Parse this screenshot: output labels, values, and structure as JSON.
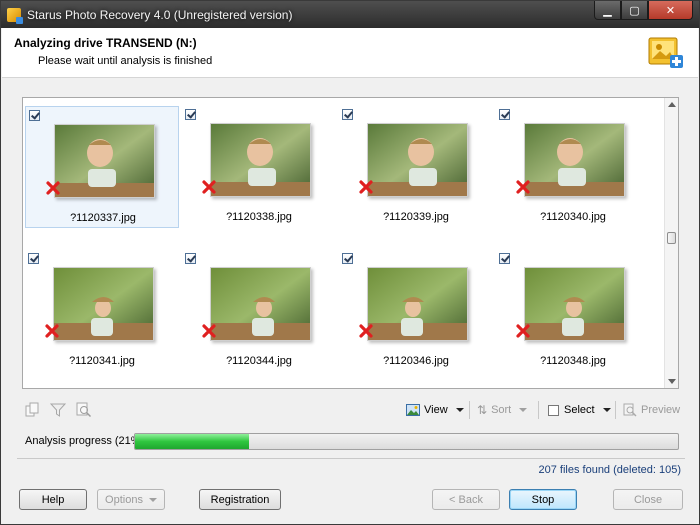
{
  "window": {
    "title": "Starus Photo Recovery 4.0 (Unregistered version)",
    "minimize_glyph": "▁",
    "maximize_glyph": "▢",
    "close_glyph": "✕"
  },
  "header": {
    "title": "Analyzing drive TRANSEND (N:)",
    "subtitle": "Please wait until analysis is finished"
  },
  "files": [
    {
      "name": "?1120337.jpg",
      "checked": true,
      "selected": true,
      "status": "deleted"
    },
    {
      "name": "?1120338.jpg",
      "checked": true,
      "selected": false,
      "status": "deleted"
    },
    {
      "name": "?1120339.jpg",
      "checked": true,
      "selected": false,
      "status": "deleted"
    },
    {
      "name": "?1120340.jpg",
      "checked": true,
      "selected": false,
      "status": "deleted"
    },
    {
      "name": "?1120341.jpg",
      "checked": true,
      "selected": false,
      "status": "deleted"
    },
    {
      "name": "?1120344.jpg",
      "checked": true,
      "selected": false,
      "status": "deleted"
    },
    {
      "name": "?1120346.jpg",
      "checked": true,
      "selected": false,
      "status": "deleted"
    },
    {
      "name": "?1120348.jpg",
      "checked": true,
      "selected": false,
      "status": "deleted"
    }
  ],
  "toolbar": {
    "icons": [
      "copy-icon",
      "filter-icon",
      "find-icon"
    ],
    "view_label": "View",
    "sort_label": "Sort",
    "select_label": "Select",
    "preview_label": "Preview"
  },
  "progress": {
    "label": "Analysis progress (21%)",
    "fraction": 0.21
  },
  "status": {
    "files_found": "207 files found (deleted: 105)"
  },
  "buttons": {
    "help": "Help",
    "options": "Options",
    "registration": "Registration",
    "back": "< Back",
    "stop": "Stop",
    "close": "Close"
  },
  "colors": {
    "progress_fill": "#2fc63f",
    "deleted_mark": "#e02020",
    "files_found_text": "#1a3f7a"
  }
}
